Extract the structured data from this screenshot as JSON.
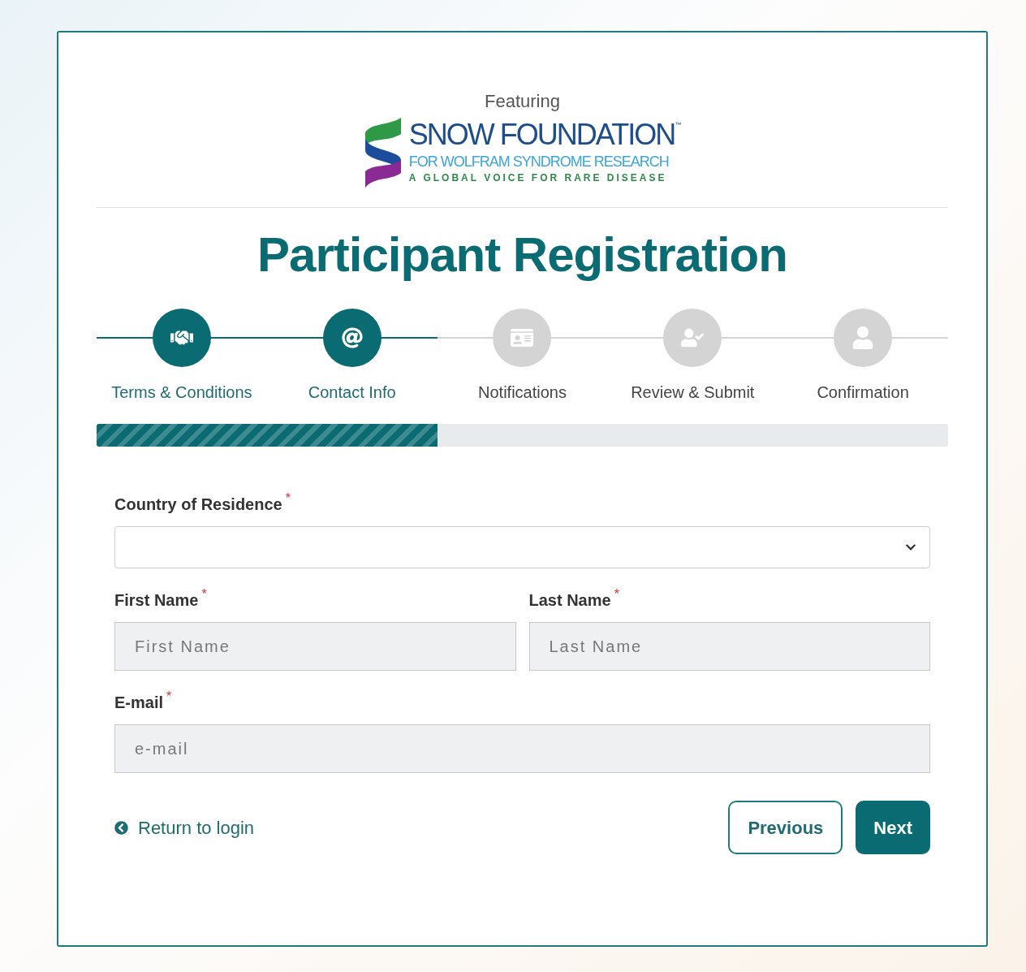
{
  "header": {
    "featuring": "Featuring",
    "logo": {
      "name": "SNOW FOUNDATION",
      "trademark": "™",
      "subtitle": "FOR WOLFRAM SYNDROME RESEARCH",
      "tagline": "A GLOBAL VOICE FOR RARE DISEASE"
    }
  },
  "title": "Participant Registration",
  "steps": [
    {
      "label": "Terms & Conditions",
      "completed": true
    },
    {
      "label": "Contact Info",
      "completed": true
    },
    {
      "label": "Notifications",
      "completed": false
    },
    {
      "label": "Review & Submit",
      "completed": false
    },
    {
      "label": "Confirmation",
      "completed": false
    }
  ],
  "progress": {
    "level": 0.4
  },
  "form": {
    "country": {
      "label": "Country of Residence",
      "required_mark": "*"
    },
    "first_name": {
      "label": "First Name",
      "required_mark": "*",
      "placeholder": "First Name"
    },
    "last_name": {
      "label": "Last Name",
      "required_mark": "*",
      "placeholder": "Last Name"
    },
    "email": {
      "label": "E-mail",
      "required_mark": "*",
      "placeholder": "e-mail"
    }
  },
  "footer": {
    "return_link": "Return to login",
    "buttons": {
      "previous": "Previous",
      "next": "Next"
    }
  }
}
